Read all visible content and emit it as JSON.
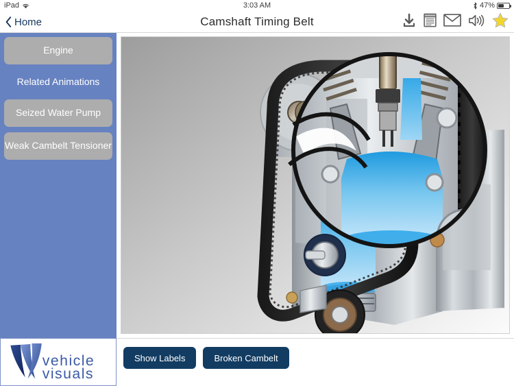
{
  "statusbar": {
    "device": "iPad",
    "wifi_icon": "wifi-icon",
    "time": "3:03 AM",
    "bluetooth_icon": "bluetooth-icon",
    "battery_percent": "47%",
    "battery_level": 47
  },
  "navbar": {
    "back_label": "Home",
    "back_icon": "chevron-left-icon",
    "title": "Camshaft Timing Belt",
    "icons": [
      {
        "name": "download-icon",
        "label": "Download"
      },
      {
        "name": "document-icon",
        "label": "Notes"
      },
      {
        "name": "envelope-icon",
        "label": "Email"
      },
      {
        "name": "speaker-icon",
        "label": "Sound"
      },
      {
        "name": "star-icon",
        "label": "Favourite"
      }
    ]
  },
  "sidebar": {
    "background_color": "#6782c0",
    "button_color": "#adadad",
    "items": [
      {
        "label": "Engine",
        "type": "button"
      },
      {
        "label": "Related Animations",
        "type": "heading"
      },
      {
        "label": "Seized Water Pump",
        "type": "button"
      },
      {
        "label": "Weak Cambelt Tensioner",
        "type": "button"
      }
    ]
  },
  "logo": {
    "line1": "vehicle",
    "line2": "visuals",
    "color": "#2b4a8f"
  },
  "content": {
    "illustration_name": "engine-camshaft-timing-belt-cutaway",
    "magnifier_name": "cylinder-magnifier-lens"
  },
  "bottombar": {
    "button_color": "#123c62",
    "buttons": [
      {
        "label": "Show Labels"
      },
      {
        "label": "Broken Cambelt"
      }
    ]
  }
}
